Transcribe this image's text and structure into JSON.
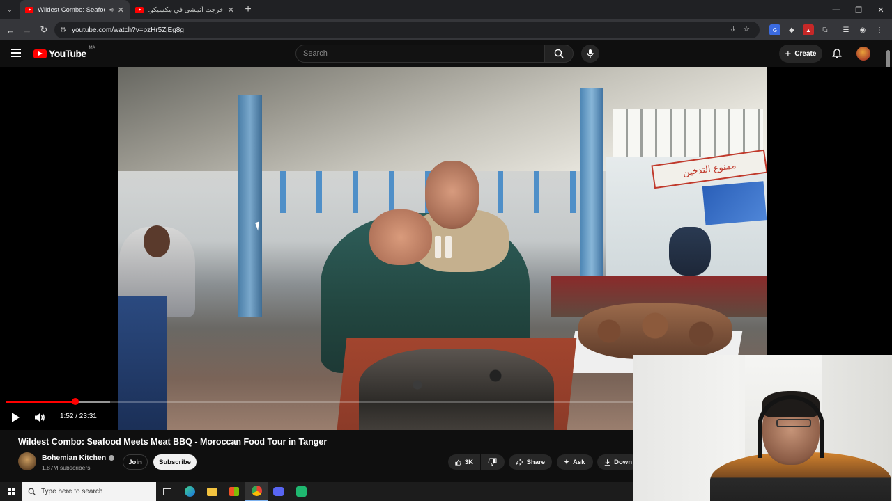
{
  "browser": {
    "tabs": [
      {
        "title": "Wildest Combo: Seafood M",
        "active": true,
        "audio": true
      },
      {
        "title": "خرجت أتمشى في مكسيكو... وتعر",
        "active": false
      }
    ],
    "url": "youtube.com/watch?v=pzHr5ZjEg8g",
    "new_tab": "+",
    "window_controls": [
      "—",
      "❐",
      "✕"
    ]
  },
  "masthead": {
    "logo_text": "YouTube",
    "region": "MA",
    "search_placeholder": "Search",
    "create_label": "Create"
  },
  "player": {
    "current_time": "1:52",
    "duration": "23:31",
    "time_display": "1:52 / 23:31",
    "progress_fraction": 0.0794,
    "state": "paused",
    "shop_sign": "ممنوع التدخين"
  },
  "video": {
    "title": "Wildest Combo: Seafood Meets Meat BBQ - Moroccan Food Tour in Tanger",
    "channel": "Bohemian Kitchen",
    "subscribers": "1.87M subscribers",
    "join_label": "Join",
    "subscribe_label": "Subscribe",
    "likes": "3K",
    "share_label": "Share",
    "ask_label": "Ask",
    "download_label": "Down"
  },
  "taskbar": {
    "search_placeholder": "Type here to search"
  },
  "colors": {
    "accent": "#ff0000",
    "background": "#0f0f0f"
  }
}
